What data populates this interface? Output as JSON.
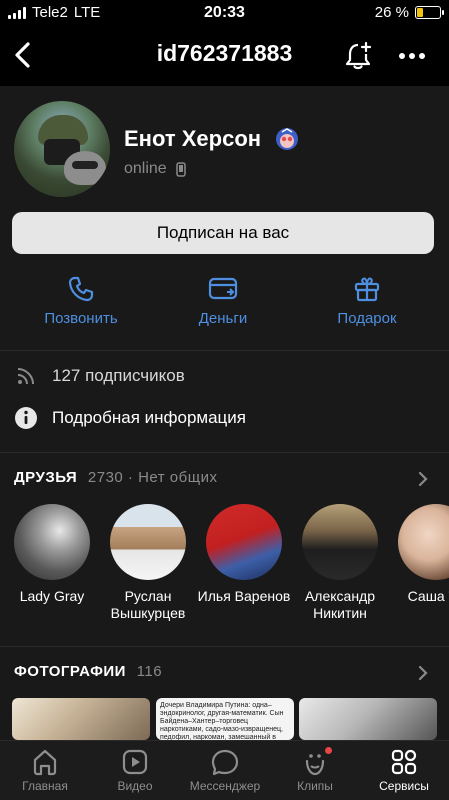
{
  "status": {
    "carrier": "Tele2",
    "network": "LTE",
    "time": "20:33",
    "battery": "26 %"
  },
  "header": {
    "title": "id762371883"
  },
  "profile": {
    "name": "Енот Херсон",
    "status": "online"
  },
  "subscribe": {
    "label": "Подписан на вас"
  },
  "actions": [
    {
      "label": "Позвонить",
      "icon": "phone-icon"
    },
    {
      "label": "Деньги",
      "icon": "money-card-icon"
    },
    {
      "label": "Подарок",
      "icon": "gift-icon"
    }
  ],
  "info": {
    "followers": "127 подписчиков",
    "details": "Подробная информация"
  },
  "friends": {
    "title": "ДРУЗЬЯ",
    "count": "2730 · Нет общих",
    "items": [
      {
        "name": "Lady Gray"
      },
      {
        "name": "Руслан Вышкурцев"
      },
      {
        "name": "Илья Варенов"
      },
      {
        "name": "Александр Никитин"
      },
      {
        "name": "Саша Ти"
      }
    ]
  },
  "photos": {
    "title": "ФОТОГРАФИИ",
    "count": "116",
    "caption": "Дочери Владимира Путина: одна–эндокринолог, другая-математик. Сын Байдена–Хантер–торговец наркотиками, садо-мазо-извращенец, педофил, наркоман, замешанный в банковских сделках с украинской мафией и так далее"
  },
  "tabbar": [
    {
      "label": "Главная",
      "icon": "home-icon"
    },
    {
      "label": "Видео",
      "icon": "video-icon"
    },
    {
      "label": "Мессенджер",
      "icon": "messenger-icon"
    },
    {
      "label": "Клипы",
      "icon": "clips-icon"
    },
    {
      "label": "Сервисы",
      "icon": "services-icon",
      "active": true
    }
  ],
  "colors": {
    "accent": "#4e8fe0",
    "background": "#191919",
    "button": "#e6e6e6"
  }
}
